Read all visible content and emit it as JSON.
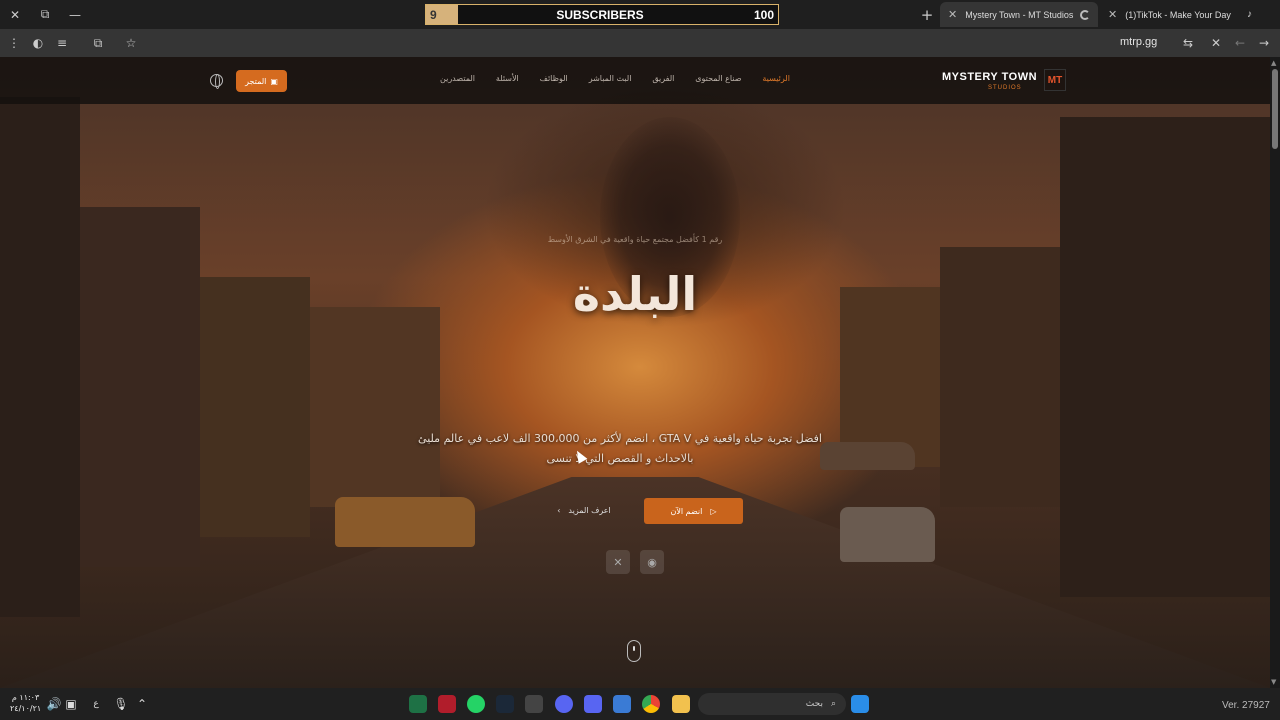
{
  "browser": {
    "window_controls": [
      "close-icon",
      "restore-icon",
      "minimize-icon"
    ],
    "subscriber_counter": {
      "current": "9",
      "label": "SUBSCRIBERS",
      "target": "100",
      "progress": 0.09
    },
    "tabs": [
      {
        "label": "Mystery Town - MT Studios | M",
        "active": true
      },
      {
        "label": "(1)TikTok - Make Your Day",
        "active": false
      }
    ],
    "url": "mtrp.gg"
  },
  "site": {
    "logo": {
      "name": "MYSTERY TOWN",
      "sub": "STUDIOS",
      "badge": "MT"
    },
    "nav": [
      "الرئيسية",
      "صناع المحتوى",
      "الفريق",
      "البث المباشر",
      "الوظائف",
      "الأسئلة",
      "المتصدرين"
    ],
    "store_label": "المتجر",
    "hero": {
      "tagline": "رقم 1 كأفضل مجتمع حياة واقعية في الشرق الأوسط",
      "title": "البلدة",
      "description": "افضل تجربة حياة واقعية في GTA V ، انضم لأكثر من 300،000 الف لاعب في عالم مليئ بالاحداث و القصص التي لا تنسى",
      "learn_more": "اعرف المزيد",
      "join_now": "انضم الآن"
    },
    "social": [
      "x-icon",
      "discord-icon"
    ],
    "accent_color": "#d56b1f"
  },
  "taskbar": {
    "time": "١١:٠٣ م",
    "date": "٢٤/١٠/٢١",
    "lang": "ع",
    "search_placeholder": "بحث",
    "version": "Ver. 27927"
  }
}
